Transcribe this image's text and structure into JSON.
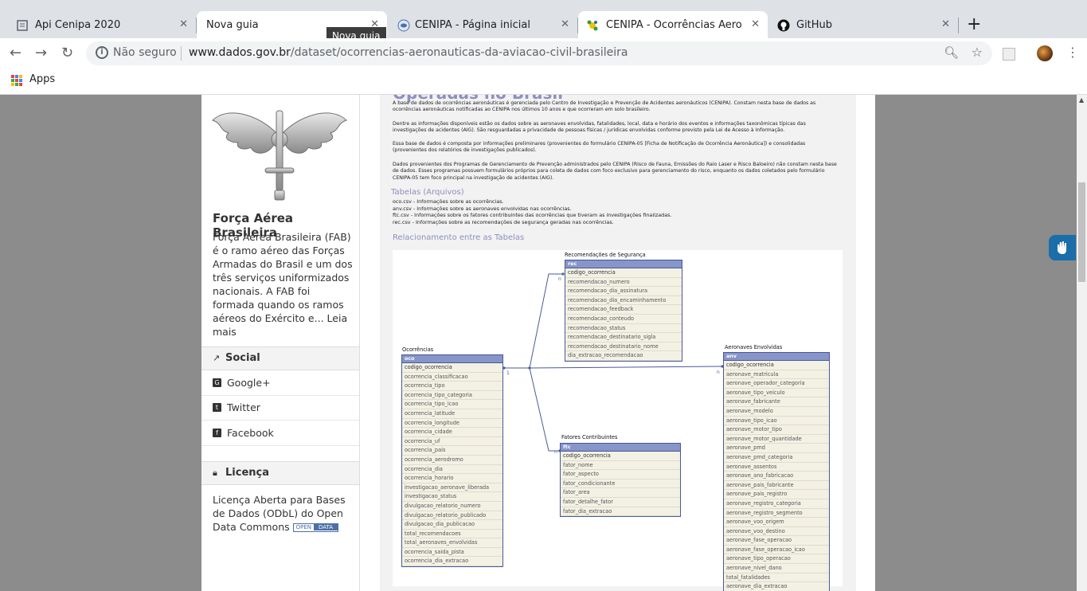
{
  "tabs": [
    {
      "title": "Api Cenipa 2020"
    },
    {
      "title": "Nova guia"
    },
    {
      "title": "CENIPA - Página inicial"
    },
    {
      "title": "CENIPA - Ocorrências Aeronáuti"
    },
    {
      "title": "GitHub"
    }
  ],
  "tooltip": "Nova guia",
  "omnibox": {
    "security": "Não seguro",
    "domain": "www.dados.gov.br",
    "path": "/dataset/ocorrencias-aeronauticas-da-aviacao-civil-brasileira"
  },
  "bookmarks": {
    "apps": "Apps"
  },
  "sidebar": {
    "org_name": "Força Aérea Brasileira",
    "org_description": "Força Aérea Brasileira (FAB) é o ramo aéreo das Forças Armadas do Brasil e um dos três serviços uniformizados nacionais. A FAB foi formada quando os ramos aéreos do Exército e...",
    "read_more": "Leia mais",
    "social_title": "Social",
    "social_links": [
      "Google+",
      "Twitter",
      "Facebook"
    ],
    "license_title": "Licença",
    "license_text": "Licença Aberta para Bases de Dados (ODbL) do Open Data Commons",
    "license_badge_left": "OPEN",
    "license_badge_right": "DATA"
  },
  "document": {
    "heading_cut": "Operadas no Brasil",
    "paragraphs": [
      "A base de dados de ocorrências aeronáuticas é gerenciada pelo Centro de Investigação e Prevenção de Acidentes aeronáuticos (CENIPA). Constam nesta base de dados as ocorrências aeronáuticas notificadas ao CENIPA nos últimos 10 anos e que ocorreram em solo brasileiro.",
      "Dentre as informações disponíveis estão os dados sobre as aeronaves envolvidas, fatalidades, local, data e horário dos eventos e informações taxonômicas típicas das investigações de acidentes (AIG). São resguardadas a privacidade de pessoas físicas / jurídicas envolvidas conforme previsto pela Lei de Acesso à Informação.",
      "Essa base de dados é composta por informações preliminares (provenientes do formulário CENIPA-05 [Ficha de Notificação de Ocorrência Aeronáutica]) e consolidadas (provenientes dos relatórios de investigações publicados).",
      "Dados provenientes dos Programas de Gerenciamento de Prevenção administrados pelo CENIPA (Risco de Fauna, Emissões do Raio Laser e Risco Baloeiro) não constam nesta base de dados. Esses programas possuem formulários próprios para coleta de dados com foco exclusivo para gerenciamento do risco, enquanto os dados coletados pelo formulário CENIPA-05 tem foco principal na investigação de acidentes (AIG)."
    ],
    "tables_heading": "Tabelas (Arquivos)",
    "tables_list": [
      "oco.csv - Informações sobre as ocorrências.",
      "anv.csv - Informações sobre as aeronaves envolvidas nas ocorrências.",
      "ftc.csv - Informações sobre os fatores contribuintes das ocorrências que tiveram as investigações finalizadas.",
      "rec.csv - Informações sobre as recomendações de segurança geradas nas ocorrências."
    ],
    "relation_heading": "Relacionamento entre as Tabelas"
  },
  "diagram": {
    "rec": {
      "title": "Recomendações de Segurança",
      "key": "rec",
      "fields": [
        "codigo_ocorrencia",
        "recomendacao_numero",
        "recomendacao_dia_assinatura",
        "recomendacao_dia_encaminhamento",
        "recomendacao_feedback",
        "recomendacao_conteudo",
        "recomendacao_status",
        "recomendacao_destinatario_sigla",
        "recomendacao_destinatario_nome",
        "dia_extracao_recomendacao"
      ]
    },
    "oco": {
      "title": "Ocorrências",
      "key": "oco",
      "fields": [
        "codigo_ocorrencia",
        "ocorrencia_classificacao",
        "ocorrencia_tipo",
        "ocorrencia_tipo_categoria",
        "ocorrencia_tipo_icao",
        "ocorrencia_latitude",
        "ocorrencia_longitude",
        "ocorrencia_cidade",
        "ocorrencia_uf",
        "ocorrencia_pais",
        "ocorrencia_aerodromo",
        "ocorrencia_dia",
        "ocorrencia_horario",
        "investigacao_aeronave_liberada",
        "investigacao_status",
        "divulgacao_relatorio_numero",
        "divulgacao_relatorio_publicado",
        "divulgacao_dia_publicacao",
        "total_recomendacoes",
        "total_aeronaves_envolvidas",
        "ocorrencia_saida_pista",
        "ocorrencia_dia_extracao"
      ]
    },
    "ftc": {
      "title": "Fatores Contribuintes",
      "key": "ftc",
      "fields": [
        "codigo_ocorrencia",
        "fator_nome",
        "fator_aspecto",
        "fator_condicionante",
        "fator_area",
        "fator_detalhe_fator",
        "fator_dia_extracao"
      ]
    },
    "anv": {
      "title": "Aeronaves Envolvidas",
      "key": "anv",
      "fields": [
        "codigo_ocorrencia",
        "aeronave_matricula",
        "aeronave_operador_categoria",
        "aeronave_tipo_veiculo",
        "aeronave_fabricante",
        "aeronave_modelo",
        "aeronave_tipo_icao",
        "aeronave_motor_tipo",
        "aeronave_motor_quantidade",
        "aeronave_pmd",
        "aeronave_pmd_categoria",
        "aeronave_assentos",
        "aeronave_ano_fabricacao",
        "aeronave_pais_fabricante",
        "aeronave_pais_registro",
        "aeronave_registro_categoria",
        "aeronave_registro_segmento",
        "aeronave_voo_origem",
        "aeronave_voo_destino",
        "aeronave_fase_operacao",
        "aeronave_fase_operacao_icao",
        "aeronave_tipo_operacao",
        "aeronave_nivel_dano",
        "total_fatalidades",
        "aeronave_dia_extracao"
      ]
    },
    "card_one": "1",
    "card_many": "n"
  },
  "colors": {
    "accent": "#8e8fbc",
    "entity_header": "#8795c9",
    "vlibras": "#1b6ea8"
  }
}
